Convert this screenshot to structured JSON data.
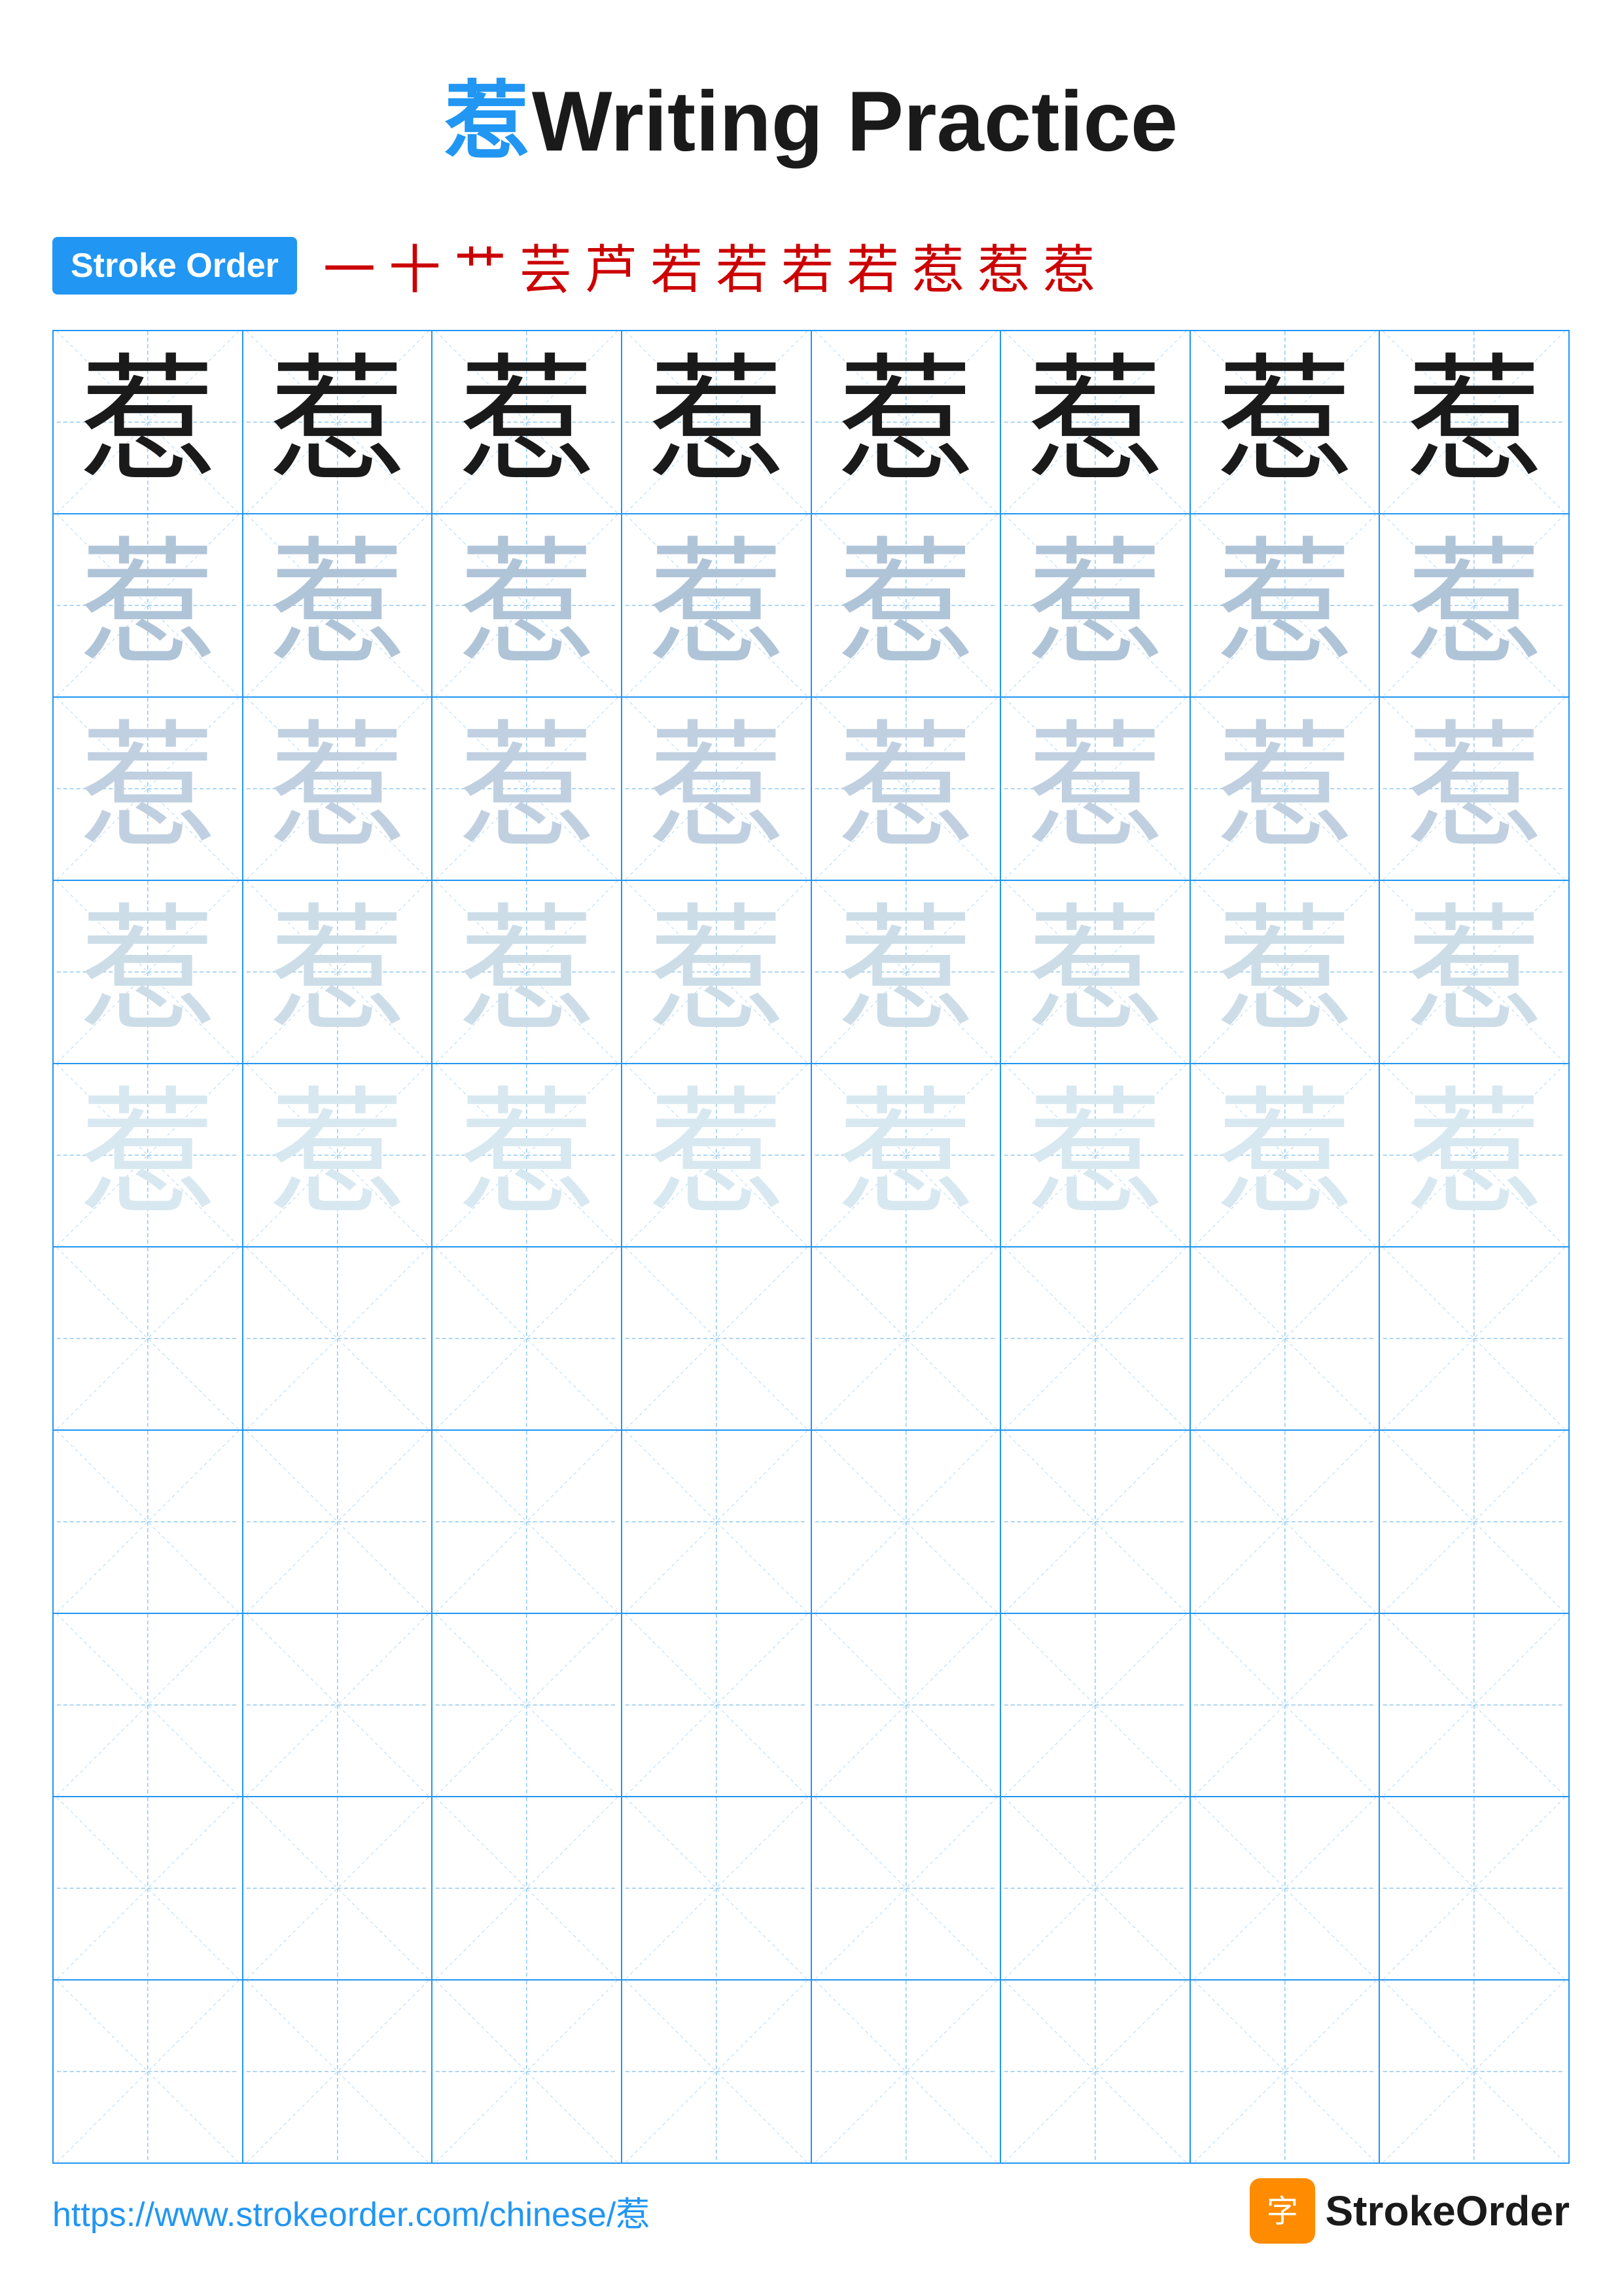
{
  "title": {
    "char": "惹",
    "text": "Writing Practice",
    "stroke_order_label": "Stroke Order",
    "stroke_chars": [
      "一",
      "十",
      "艹",
      "芸",
      "芦",
      "若",
      "若",
      "若",
      "若",
      "惹",
      "惹",
      "惹"
    ]
  },
  "grid": {
    "rows": 10,
    "cols": 8,
    "char": "惹",
    "filled_rows": 5,
    "row_opacities": [
      "dark",
      "light1",
      "light2",
      "light3",
      "light4"
    ]
  },
  "footer": {
    "url": "https://www.strokeorder.com/chinese/惹",
    "logo_text": "StrokeOrder"
  }
}
